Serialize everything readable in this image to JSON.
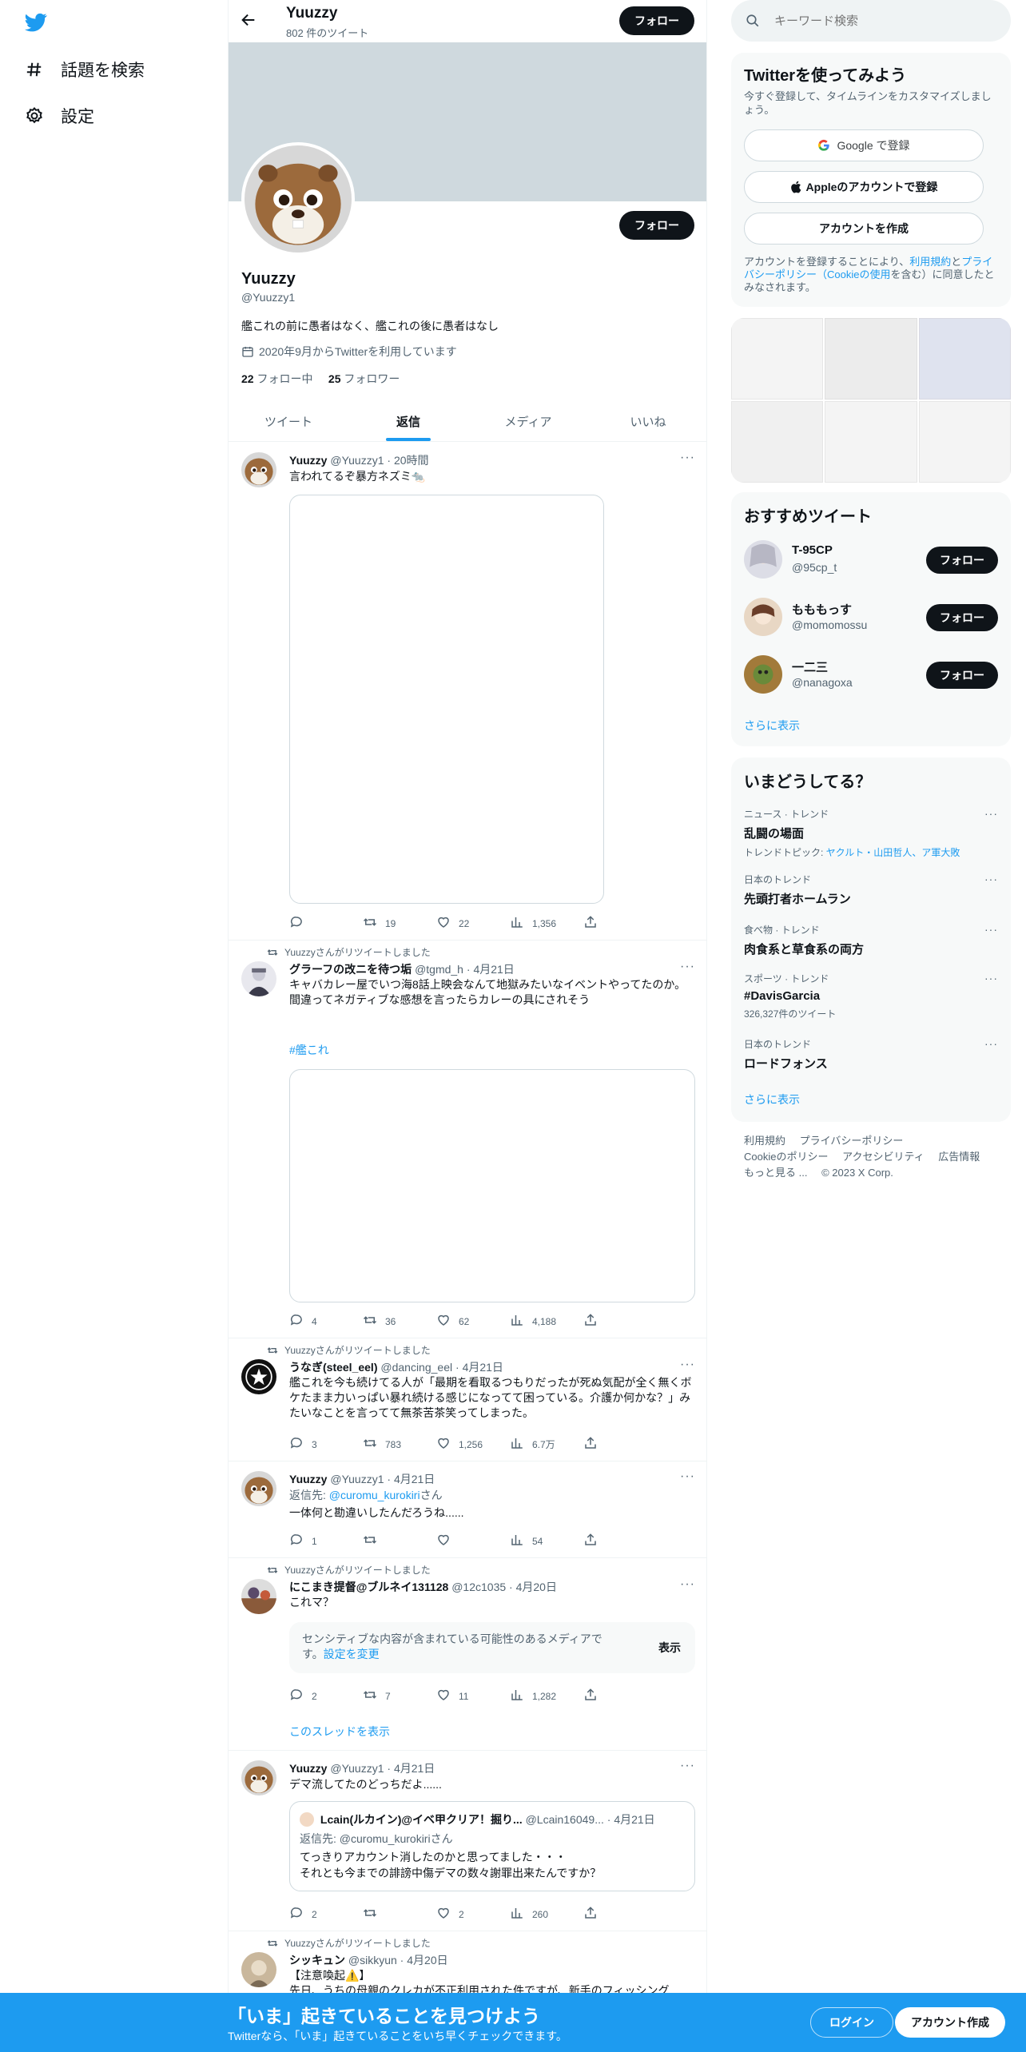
{
  "nav": {
    "explore_label": "話題を検索",
    "settings_label": "設定"
  },
  "header": {
    "name": "Yuuzzy",
    "tweet_count": "802 件のツイート",
    "follow_label": "フォロー"
  },
  "profile": {
    "name": "Yuuzzy",
    "handle": "@Yuuzzy1",
    "bio": "艦これの前に愚者はなく、艦これの後に愚者はなし",
    "joined": "2020年9月からTwitterを利用しています",
    "following_count": "22",
    "following_label": "フォロー中",
    "followers_count": "25",
    "followers_label": "フォロワー",
    "follow_label": "フォロー"
  },
  "tabs": [
    "ツイート",
    "返信",
    "メディア",
    "いいね"
  ],
  "tweets": [
    {
      "name": "Yuuzzy",
      "handle": "@Yuuzzy1",
      "time": "20時間",
      "text": "言われてるぞ暴方ネズミ🐀",
      "replies": "",
      "retweets": "19",
      "likes": "22",
      "views": "1,356"
    },
    {
      "retweeted_by": "Yuuzzyさんがリツイートしました",
      "name": "グラーフの改ニを待つ垢",
      "handle": "@tgmd_h",
      "time": "4月21日",
      "text": "キャバカレー屋でいつ海8話上映会なんて地獄みたいなイベントやってたのか。\n間違ってネガティブな感想を言ったらカレーの具にされそう",
      "hashtag": "#艦これ",
      "replies": "4",
      "retweets": "36",
      "likes": "62",
      "views": "4,188"
    },
    {
      "retweeted_by": "Yuuzzyさんがリツイートしました",
      "name": "うなぎ(steel_eel)",
      "handle": "@dancing_eel",
      "time": "4月21日",
      "text": "艦これを今も続けてる人が「最期を看取るつもりだったが死ぬ気配が全く無くボケたまま力いっぱい暴れ続ける感じになってて困っている。介護か何かな？」みたいなことを言ってて無茶苦茶笑ってしまった。",
      "replies": "3",
      "retweets": "783",
      "likes": "1,256",
      "views": "6.7万"
    },
    {
      "name": "Yuuzzy",
      "handle": "@Yuuzzy1",
      "time": "4月21日",
      "reply_prefix": "返信先: ",
      "reply_to": "@curomu_kurokiri",
      "reply_suffix": "さん",
      "text": "一体何と勘違いしたんだろうね......",
      "replies": "1",
      "retweets": "",
      "likes": "",
      "views": "54"
    },
    {
      "retweeted_by": "Yuuzzyさんがリツイートしました",
      "name": "にこまき提督@ブルネイ131128",
      "handle": "@12c1035",
      "time": "4月20日",
      "text": "これマ？",
      "sensitive_text": "センシティブな内容が含まれている可能性のあるメディアです。",
      "sensitive_link": "設定を変更",
      "show_label": "表示",
      "replies": "2",
      "retweets": "7",
      "likes": "11",
      "views": "1,282",
      "show_thread": "このスレッドを表示"
    },
    {
      "name": "Yuuzzy",
      "handle": "@Yuuzzy1",
      "time": "4月21日",
      "text": "デマ流してたのどっちだよ......",
      "quote": {
        "name": "Lcain(ルカイン)@イベ甲クリア！掘り...",
        "handle": "@Lcain16049...",
        "time": "4月21日",
        "reply_line": "返信先: @curomu_kurokiriさん",
        "text": "てっきりアカウント消したのかと思ってました・・・\nそれとも今までの誹謗中傷デマの数々謝罪出来たんですか？"
      },
      "replies": "2",
      "retweets": "",
      "likes": "2",
      "views": "260"
    },
    {
      "retweeted_by": "Yuuzzyさんがリツイートしました",
      "name": "シッキュン",
      "handle": "@sikkyun",
      "time": "4月20日",
      "text": "【注意喚起⚠️】\n先日、うちの母親のクレカが不正利用された件ですが、新手のフィッシング"
    }
  ],
  "sidebar": {
    "search_placeholder": "キーワード検索",
    "signup": {
      "title": "Twitterを使ってみよう",
      "subtitle": "今すぐ登録して、タイムラインをカスタマイズしましょう。",
      "google_label": "Google で登録",
      "apple_label": "Appleのアカウントで登録",
      "create_label": "アカウントを作成",
      "terms_pre": "アカウントを登録することにより、",
      "terms_link": "利用規約",
      "terms_mid": "と",
      "privacy_link": "プライバシーポリシー（Cookieの使用",
      "terms_post": "を含む）に同意したとみなされます。"
    },
    "recommended": {
      "title": "おすすめツイート",
      "users": [
        {
          "name": "T-95CP",
          "handle": "@95cp_t",
          "follow": "フォロー"
        },
        {
          "name": "もももっす",
          "handle": "@momomossu",
          "follow": "フォロー"
        },
        {
          "name": "一二三",
          "handle": "@nanagoxa",
          "follow": "フォロー"
        }
      ],
      "more": "さらに表示"
    },
    "trends": {
      "title": "いまどうしてる？",
      "items": [
        {
          "category": "ニュース · トレンド",
          "title": "乱闘の場面",
          "sub_prefix": "トレンドトピック: ",
          "sub_link": "ヤクルト・山田哲人、ア軍大敗"
        },
        {
          "category": "日本のトレンド",
          "title": "先頭打者ホームラン"
        },
        {
          "category": "食べ物 · トレンド",
          "title": "肉食系と草食系の両方"
        },
        {
          "category": "スポーツ · トレンド",
          "title": "#DavisGarcia",
          "sub": "326,327件のツイート"
        },
        {
          "category": "日本のトレンド",
          "title": "ロードフォンス"
        }
      ],
      "more": "さらに表示"
    },
    "footer": [
      "利用規約",
      "プライバシーポリシー",
      "Cookieのポリシー",
      "アクセシビリティ",
      "広告情報",
      "もっと見る ...",
      "© 2023 X Corp."
    ]
  },
  "bottom_bar": {
    "title": "「いま」起きていることを見つけよう",
    "subtitle": "Twitterなら、「いま」起きていることをいち早くチェックできます。",
    "login": "ログイン",
    "signup": "アカウント作成"
  },
  "colors": {
    "accent": "#1d9bf0",
    "text": "#0f1419",
    "muted": "#536471",
    "banner": "#cfd9de"
  }
}
